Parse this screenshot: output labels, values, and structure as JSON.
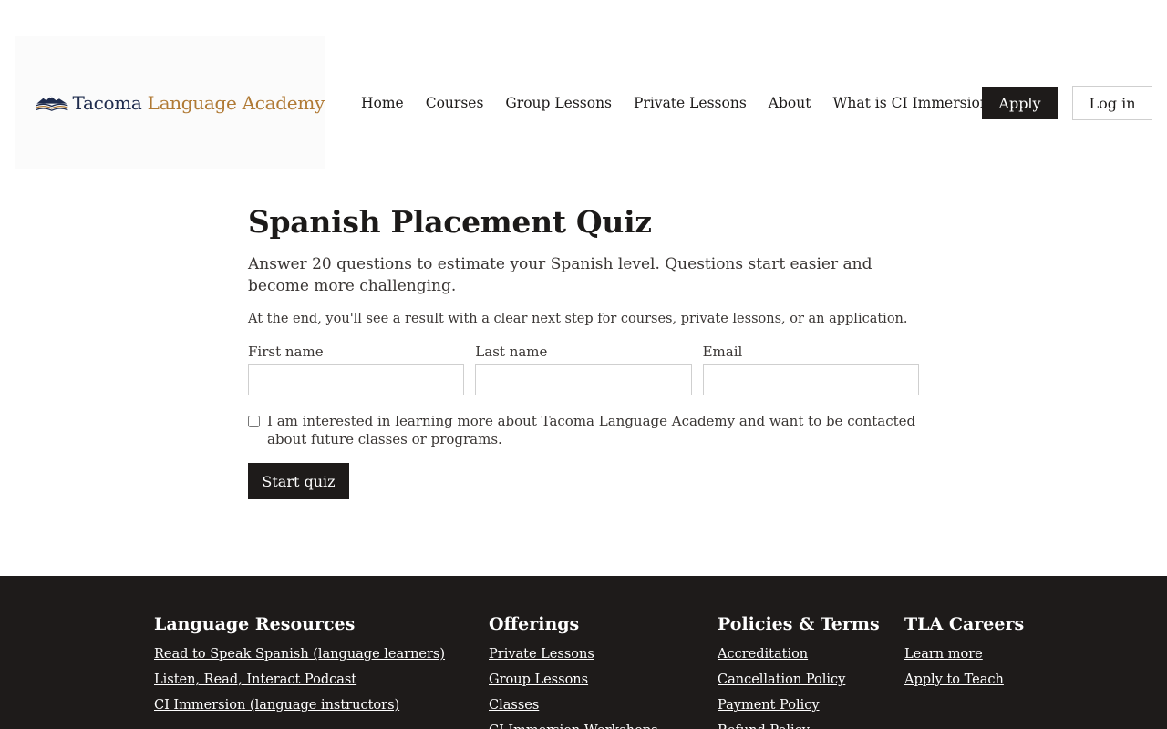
{
  "header": {
    "logo": {
      "name_part1": "Tacoma",
      "name_part2": "Language Academy",
      "icon": "mountain-book-logo"
    },
    "nav": [
      "Home",
      "Courses",
      "Group Lessons",
      "Private Lessons",
      "About",
      "What is CI Immersion™?"
    ],
    "apply_label": "Apply",
    "login_label": "Log in"
  },
  "main": {
    "title": "Spanish Placement Quiz",
    "lead": "Answer 20 questions to estimate your Spanish level. Questions start easier and become more challenging.",
    "sub": "At the end, you'll see a result with a clear next step for courses, private lessons, or an application.",
    "fields": {
      "first_name_label": "First name",
      "first_name_value": "",
      "last_name_label": "Last name",
      "last_name_value": "",
      "email_label": "Email",
      "email_value": ""
    },
    "consent_label": "I am interested in learning more about Tacoma Language Academy and want to be contacted about future classes or programs.",
    "consent_checked": false,
    "start_label": "Start quiz"
  },
  "footer": {
    "columns": [
      {
        "title": "Language Resources",
        "links": [
          "Read to Speak Spanish (language learners)",
          "Listen, Read, Interact Podcast",
          "CI Immersion (language instructors)"
        ]
      },
      {
        "title": "Offerings",
        "links": [
          "Private Lessons",
          "Group Lessons",
          "Classes",
          "CI Immersion Workshops"
        ]
      },
      {
        "title": "Policies & Terms",
        "links": [
          "Accreditation",
          "Cancellation Policy",
          "Payment Policy",
          "Refund Policy"
        ]
      },
      {
        "title": "TLA Careers",
        "links": [
          "Learn more",
          "Apply to Teach"
        ]
      }
    ]
  },
  "colors": {
    "brand_navy": "#1f2c4e",
    "brand_gold": "#b07a35",
    "dark": "#1e1b1a"
  }
}
